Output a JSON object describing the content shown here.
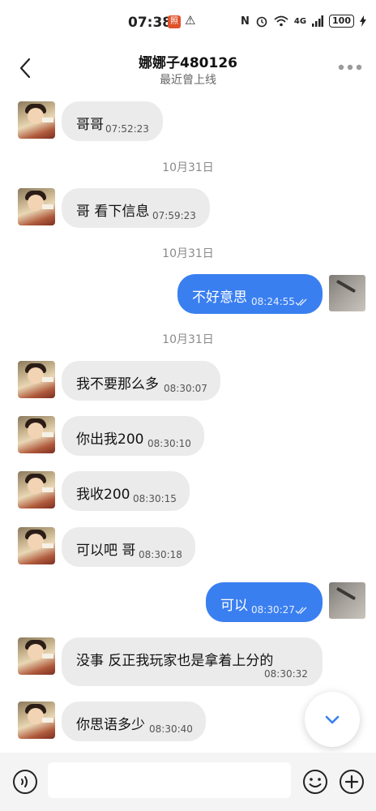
{
  "status_bar": {
    "time": "07:38",
    "badge": "照",
    "warn": "⚠",
    "nfc": "N",
    "net": "4G",
    "battery": "100"
  },
  "header": {
    "title": "娜娜子480126",
    "subtitle": "最近曾上线"
  },
  "messages": [
    {
      "dir": "in",
      "text": "哥哥",
      "time": "07:52:23"
    },
    {
      "date": "10月31日"
    },
    {
      "dir": "in",
      "text": "哥 看下信息",
      "time": "07:59:23"
    },
    {
      "date": "10月31日"
    },
    {
      "dir": "out",
      "text": "不好意思",
      "time": "08:24:55",
      "read": true
    },
    {
      "date": "10月31日"
    },
    {
      "dir": "in",
      "text": "我不要那么多",
      "time": "08:30:07"
    },
    {
      "dir": "in",
      "text": "你出我200",
      "time": "08:30:10"
    },
    {
      "dir": "in",
      "text": "我收200",
      "time": "08:30:15"
    },
    {
      "dir": "in",
      "text": "可以吧 哥",
      "time": "08:30:18"
    },
    {
      "dir": "out",
      "text": "可以",
      "time": "08:30:27",
      "read": true
    },
    {
      "dir": "in",
      "text": "没事 反正我玩家也是拿着上分的",
      "time": "08:30:32"
    },
    {
      "dir": "in",
      "text": "你思语多少",
      "time": "08:30:40"
    }
  ],
  "input": {
    "placeholder": ""
  },
  "colors": {
    "accent": "#3a7ff0",
    "bubble_in": "#ebebeb",
    "input_bar": "#f4f4f4"
  },
  "icons": [
    "back-arrow-icon",
    "more-dots-icon",
    "voice-icon",
    "emoji-icon",
    "plus-icon",
    "chevron-down-icon",
    "double-check-icon"
  ]
}
